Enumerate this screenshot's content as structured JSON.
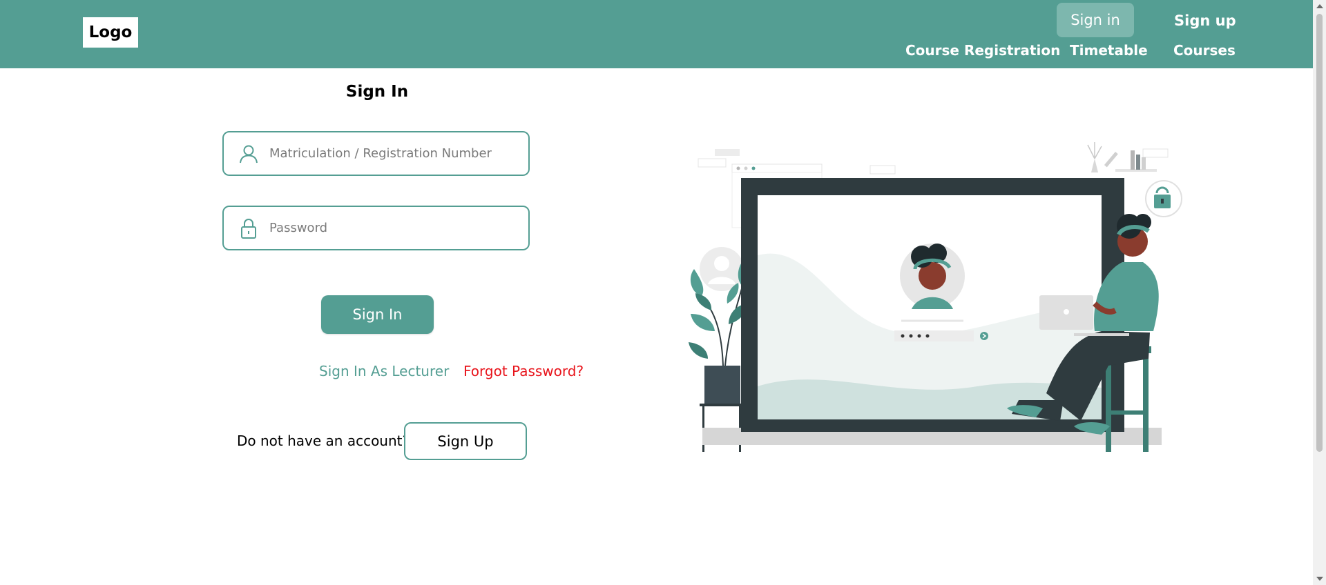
{
  "header": {
    "logo_text": "Logo",
    "nav": {
      "sign_in": "Sign in",
      "sign_up": "Sign up",
      "course_registration": "Course Registration",
      "timetable": "Timetable",
      "courses": "Courses"
    }
  },
  "form": {
    "title": "Sign In",
    "matric_placeholder": "Matriculation / Registration Number",
    "password_placeholder": "Password",
    "submit_label": "Sign In",
    "lecturer_link": "Sign In As Lecturer",
    "forgot_link": "Forgot Password?",
    "no_account_text": "Do not have an account?",
    "signup_label": "Sign Up"
  },
  "illustration": {
    "icon": "login-illustration",
    "password_dots": "••••"
  },
  "colors": {
    "brand": "#549e93",
    "brand_light": "#7db7ae",
    "danger": "#e8141b",
    "dark": "#2f3b3f"
  }
}
